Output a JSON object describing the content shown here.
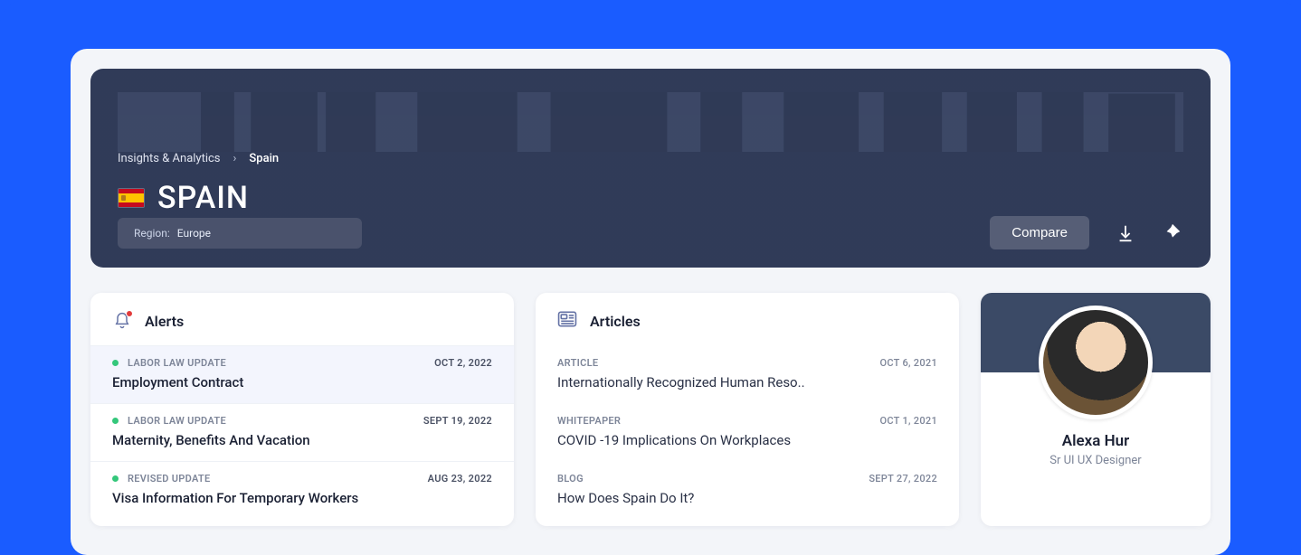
{
  "breadcrumb": {
    "root": "Insights & Analytics",
    "current": "Spain"
  },
  "country": {
    "name": "SPAIN"
  },
  "region": {
    "label": "Region:",
    "value": "Europe"
  },
  "actions": {
    "compare": "Compare"
  },
  "alerts": {
    "title": "Alerts",
    "items": [
      {
        "category": "LABOR LAW UPDATE",
        "date": "OCT 2, 2022",
        "title": "Employment Contract"
      },
      {
        "category": "LABOR LAW UPDATE",
        "date": "SEPT 19, 2022",
        "title": "Maternity, Benefits And Vacation"
      },
      {
        "category": "REVISED UPDATE",
        "date": "AUG 23, 2022",
        "title": "Visa Information For Temporary Workers"
      }
    ]
  },
  "articles": {
    "title": "Articles",
    "items": [
      {
        "category": "ARTICLE",
        "date": "OCT 6, 2021",
        "title": "Internationally Recognized Human Reso.."
      },
      {
        "category": "WHITEPAPER",
        "date": "OCT 1, 2021",
        "title": "COVID -19 Implications On Workplaces"
      },
      {
        "category": "BLOG",
        "date": "SEPT 27, 2022",
        "title": "How Does Spain Do It?"
      }
    ]
  },
  "profile": {
    "name": "Alexa Hur",
    "role": "Sr UI UX Designer"
  }
}
